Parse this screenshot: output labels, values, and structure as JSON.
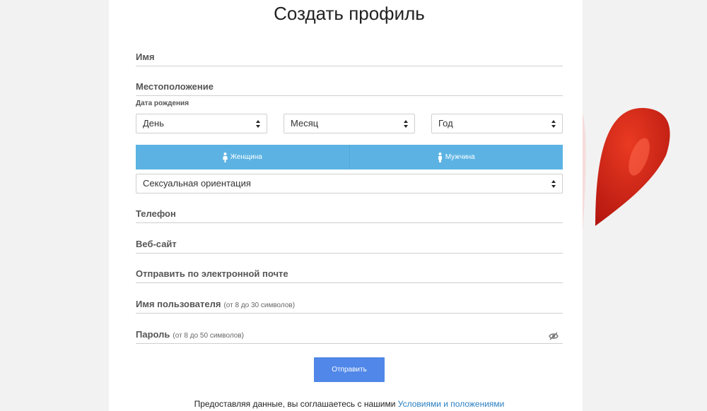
{
  "form": {
    "title": "Создать профиль",
    "name_label": "Имя",
    "location_label": "Местоположение",
    "birthdate_label": "Дата рождения",
    "day_select": "День",
    "month_select": "Месяц",
    "year_select": "Год",
    "gender_female": "Женщина",
    "gender_male": "Мужчина",
    "orientation_select": "Сексуальная ориентация",
    "phone_label": "Телефон",
    "website_label": "Веб-сайт",
    "email_label": "Отправить по электронной почте",
    "username_label": "Имя пользователя",
    "username_hint": "(от 8 до 30 символов)",
    "password_label": "Пароль",
    "password_hint": "(от 8 до 50 символов)",
    "submit_label": "Отправить",
    "terms_text": "Предоставляя данные, вы соглашаетесь с нашими ",
    "terms_link": "Условиями и положениями"
  },
  "icons": {
    "gender_female": "female-person-icon",
    "gender_male": "male-person-icon",
    "password_toggle": "eye-off-icon",
    "select_arrows": "sort-arrows-icon",
    "decoration": "heart-balloon-icon"
  },
  "colors": {
    "gender_bar": "#5cb3e3",
    "submit_button": "#5087e8",
    "link": "#2a7fc1",
    "heart": "#d42a1e"
  }
}
